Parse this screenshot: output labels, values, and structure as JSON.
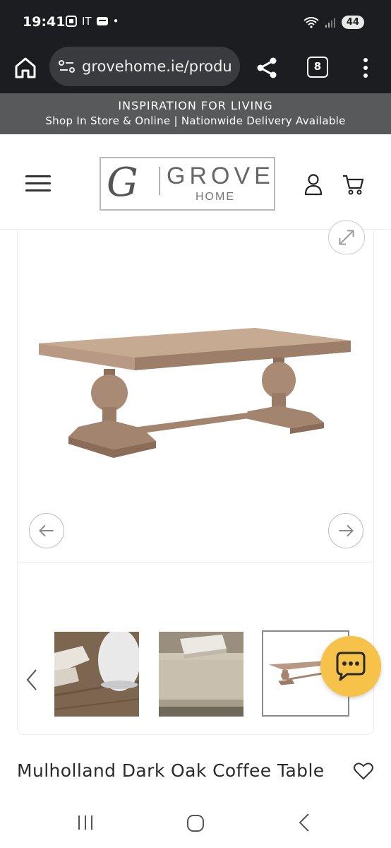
{
  "status_bar": {
    "time": "19:41",
    "left_icons": [
      "screenshot-icon",
      "IT",
      "message-icon",
      "•"
    ],
    "left_text": "IT",
    "battery": "44"
  },
  "browser": {
    "url": "grovehome.ie/produ",
    "tab_count": "8"
  },
  "promo": {
    "line1": "INSPIRATION FOR LIVING",
    "line2": "Shop In Store & Online | Nationwide Delivery Available"
  },
  "logo": {
    "monogram": "G",
    "word": "GROVE",
    "sub": "HOME"
  },
  "product": {
    "title": "Mulholland Dark Oak Coffee Table"
  },
  "colors": {
    "chrome_dark": "#1c1d20",
    "promo_bg": "#58595b",
    "chat_accent": "#f7c24a",
    "wood": "#b0907a"
  }
}
